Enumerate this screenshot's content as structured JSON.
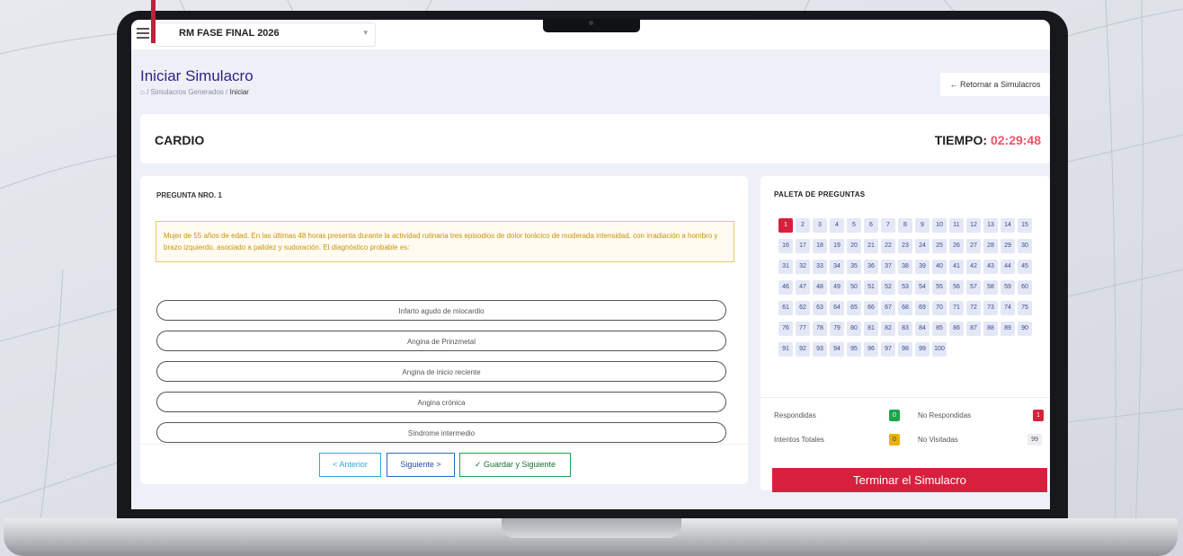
{
  "topbar": {
    "course_select_value": "RM FASE FINAL 2026",
    "chevron_glyph": "▾"
  },
  "header": {
    "page_title": "Iniciar Simulacro",
    "breadcrumb": {
      "home_glyph": "⌂",
      "separator": "/",
      "level1": "Simulacros Generados",
      "current": "Iniciar"
    },
    "back_button_label": "← Retornar a Simulacros"
  },
  "exam": {
    "subject": "CARDIO",
    "timer_label": "TIEMPO:",
    "timer_value": "02:29:48"
  },
  "question": {
    "number_label": "PREGUNTA NRO. 1",
    "text": "Mujer de 55 años de edad. En las últimas 48 horas presenta durante la actividad rutinaria tres episodios de dolor torácico de moderada intensidad, con irradiación a hombro y brazo izquierdo, asociado a palidez y sudoración. El diagnóstico probable es:",
    "options": [
      "Infarto agudo de miocardio",
      "Angina de Prinzmetal",
      "Angina de inicio reciente",
      "Angina crónica",
      "Síndrome intermedio"
    ]
  },
  "nav": {
    "prev_label": "< Anterior",
    "next_label": "Siguiente >",
    "save_next_label": "✓ Guardar y Siguiente"
  },
  "palette": {
    "title": "PALETA DE PREGUNTAS",
    "total": 100,
    "current": 1
  },
  "legend": {
    "respondidas_label": "Respondidas",
    "respondidas_count": "0",
    "no_respondidas_label": "No Respondidas",
    "no_respondidas_count": "1",
    "intentos_label": "Intentos Totales",
    "intentos_count": "0",
    "no_visitadas_label": "No Visitadas",
    "no_visitadas_count": "99"
  },
  "finish_button_label": "Terminar el Simulacro",
  "colors": {
    "accent_red": "#d8203e",
    "title_purple": "#2f1f86",
    "timer_red": "#f0526a",
    "question_amber": "#c9900f",
    "answered_green": "#1ba64a",
    "attempt_yellow": "#e8b10f"
  }
}
